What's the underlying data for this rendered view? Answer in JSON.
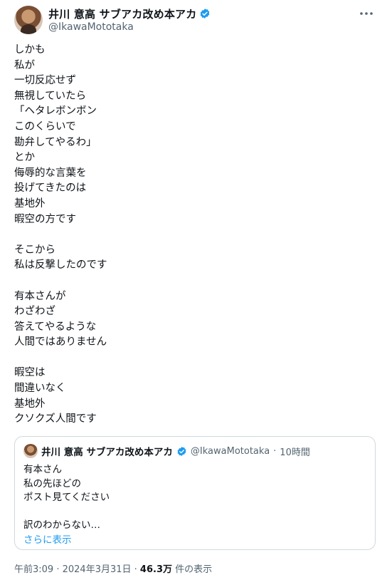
{
  "author": {
    "display_name": "井川 意高 サブアカ改め本アカ",
    "handle": "@IkawaMototaka"
  },
  "post": {
    "text": "しかも\n私が\n一切反応せず\n無視していたら\n「ヘタレボンボン\nこのくらいで\n勘弁してやるわ」\nとか\n侮辱的な言葉を\n投げてきたのは\n基地外\n暇空の方です\n\nそこから\n私は反撃したのです\n\n有本さんが\nわざわざ\n答えてやるような\n人間ではありません\n\n暇空は\n間違いなく\n基地外\nクソクズ人間です"
  },
  "quote": {
    "display_name": "井川 意高 サブアカ改め本アカ",
    "handle": "@IkawaMototaka",
    "time": "10時間",
    "text": "有本さん\n私の先ほどの\nポスト見てください\n\n訳のわからない…",
    "show_more": "さらに表示"
  },
  "meta": {
    "time": "午前3:09",
    "date": "2024年3月31日",
    "views": "46.3万",
    "views_suffix": "件の表示"
  },
  "colors": {
    "verified": "#1d9bf0",
    "link": "#1d9bf0",
    "secondary": "#536471"
  }
}
